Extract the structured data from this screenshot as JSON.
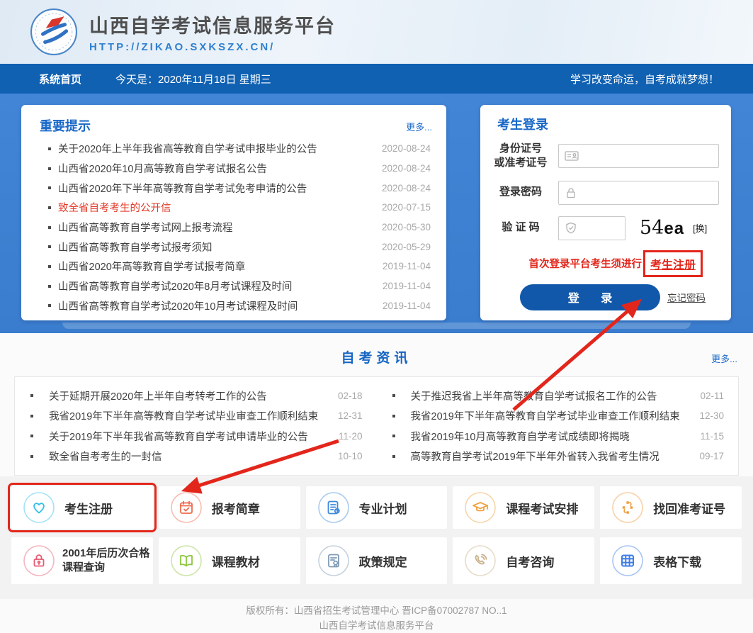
{
  "header": {
    "title": "山西自学考试信息服务平台",
    "url": "HTTP://ZIKAO.SXKSZX.CN/"
  },
  "navbar": {
    "home": "系统首页",
    "today": "今天是：2020年11月18日  星期三",
    "slogan": "学习改变命运，自考成就梦想！"
  },
  "notices": {
    "title": "重要提示",
    "more": "更多...",
    "items": [
      {
        "text": "关于2020年上半年我省高等教育自学考试申报毕业的公告",
        "date": "2020-08-24",
        "highlight": false
      },
      {
        "text": "山西省2020年10月高等教育自学考试报名公告",
        "date": "2020-08-24",
        "highlight": false
      },
      {
        "text": "山西省2020年下半年高等教育自学考试免考申请的公告",
        "date": "2020-08-24",
        "highlight": false
      },
      {
        "text": "致全省自考考生的公开信",
        "date": "2020-07-15",
        "highlight": true
      },
      {
        "text": "山西省高等教育自学考试网上报考流程",
        "date": "2020-05-30",
        "highlight": false
      },
      {
        "text": "山西省高等教育自学考试报考须知",
        "date": "2020-05-29",
        "highlight": false
      },
      {
        "text": "山西省2020年高等教育自学考试报考简章",
        "date": "2019-11-04",
        "highlight": false
      },
      {
        "text": "山西省高等教育自学考试2020年8月考试课程及时间",
        "date": "2019-11-04",
        "highlight": false
      },
      {
        "text": "山西省高等教育自学考试2020年10月考试课程及时间",
        "date": "2019-11-04",
        "highlight": false
      }
    ]
  },
  "login": {
    "title": "考生登录",
    "id_label1": "身份证号",
    "id_label2": "或准考证号",
    "id_value": "",
    "id_placeholder": "",
    "password_label": "登录密码",
    "password_value": "",
    "captcha_label": "验 证 码",
    "captcha_value": "",
    "captcha_image_prefix": "54",
    "captcha_image_suffix": "ea",
    "captcha_refresh": "[换]",
    "register_note": "首次登录平台考生须进行",
    "register_link": "考生注册",
    "login_button": "登 录",
    "forgot": "忘记密码"
  },
  "news": {
    "title": "自考资讯",
    "more": "更多...",
    "left": [
      {
        "text": "关于延期开展2020年上半年自考转考工作的公告",
        "date": "02-18"
      },
      {
        "text": "我省2019年下半年高等教育自学考试毕业审查工作顺利结束",
        "date": "12-31"
      },
      {
        "text": "关于2019年下半年我省高等教育自学考试申请毕业的公告",
        "date": "11-20"
      },
      {
        "text": "致全省自考考生的一封信",
        "date": "10-10"
      }
    ],
    "right": [
      {
        "text": "关于推迟我省上半年高等教育自学考试报名工作的公告",
        "date": "02-11"
      },
      {
        "text": "我省2019年下半年高等教育自学考试毕业审查工作顺利结束",
        "date": "12-30"
      },
      {
        "text": "我省2019年10月高等教育自学考试成绩即将揭晓",
        "date": "11-15"
      },
      {
        "text": "高等教育自学考试2019年下半年外省转入我省考生情况",
        "date": "09-17"
      }
    ]
  },
  "shortcuts": [
    {
      "label": "考生注册",
      "icon": "heart-icon",
      "color": "#35c0e8",
      "highlighted": true
    },
    {
      "label": "报考简章",
      "icon": "calendar-icon",
      "color": "#ef6a4d",
      "highlighted": false
    },
    {
      "label": "专业计划",
      "icon": "document-icon",
      "color": "#3e89dd",
      "highlighted": false
    },
    {
      "label": "课程考试安排",
      "icon": "graduation-cap-icon",
      "color": "#f0a23f",
      "highlighted": false
    },
    {
      "label": "找回准考证号",
      "icon": "flow-icon",
      "color": "#f09a3c",
      "highlighted": false
    },
    {
      "label": "2001年后历次合格课程查询",
      "icon": "lock-icon",
      "color": "#e85a72",
      "highlighted": false
    },
    {
      "label": "课程教材",
      "icon": "book-icon",
      "color": "#8dc63f",
      "highlighted": false
    },
    {
      "label": "政策规定",
      "icon": "certificate-icon",
      "color": "#7f9ab5",
      "highlighted": false
    },
    {
      "label": "自考咨询",
      "icon": "phone-icon",
      "color": "#c9b18a",
      "highlighted": false
    },
    {
      "label": "表格下载",
      "icon": "table-icon",
      "color": "#3f7de8",
      "highlighted": false
    }
  ],
  "footer": {
    "line1": "版权所有：山西省招生考试管理中心  晋ICP备07002787  NO..1",
    "line2": "山西自学考试信息服务平台"
  },
  "annotations": {
    "color": "#e3261b"
  }
}
